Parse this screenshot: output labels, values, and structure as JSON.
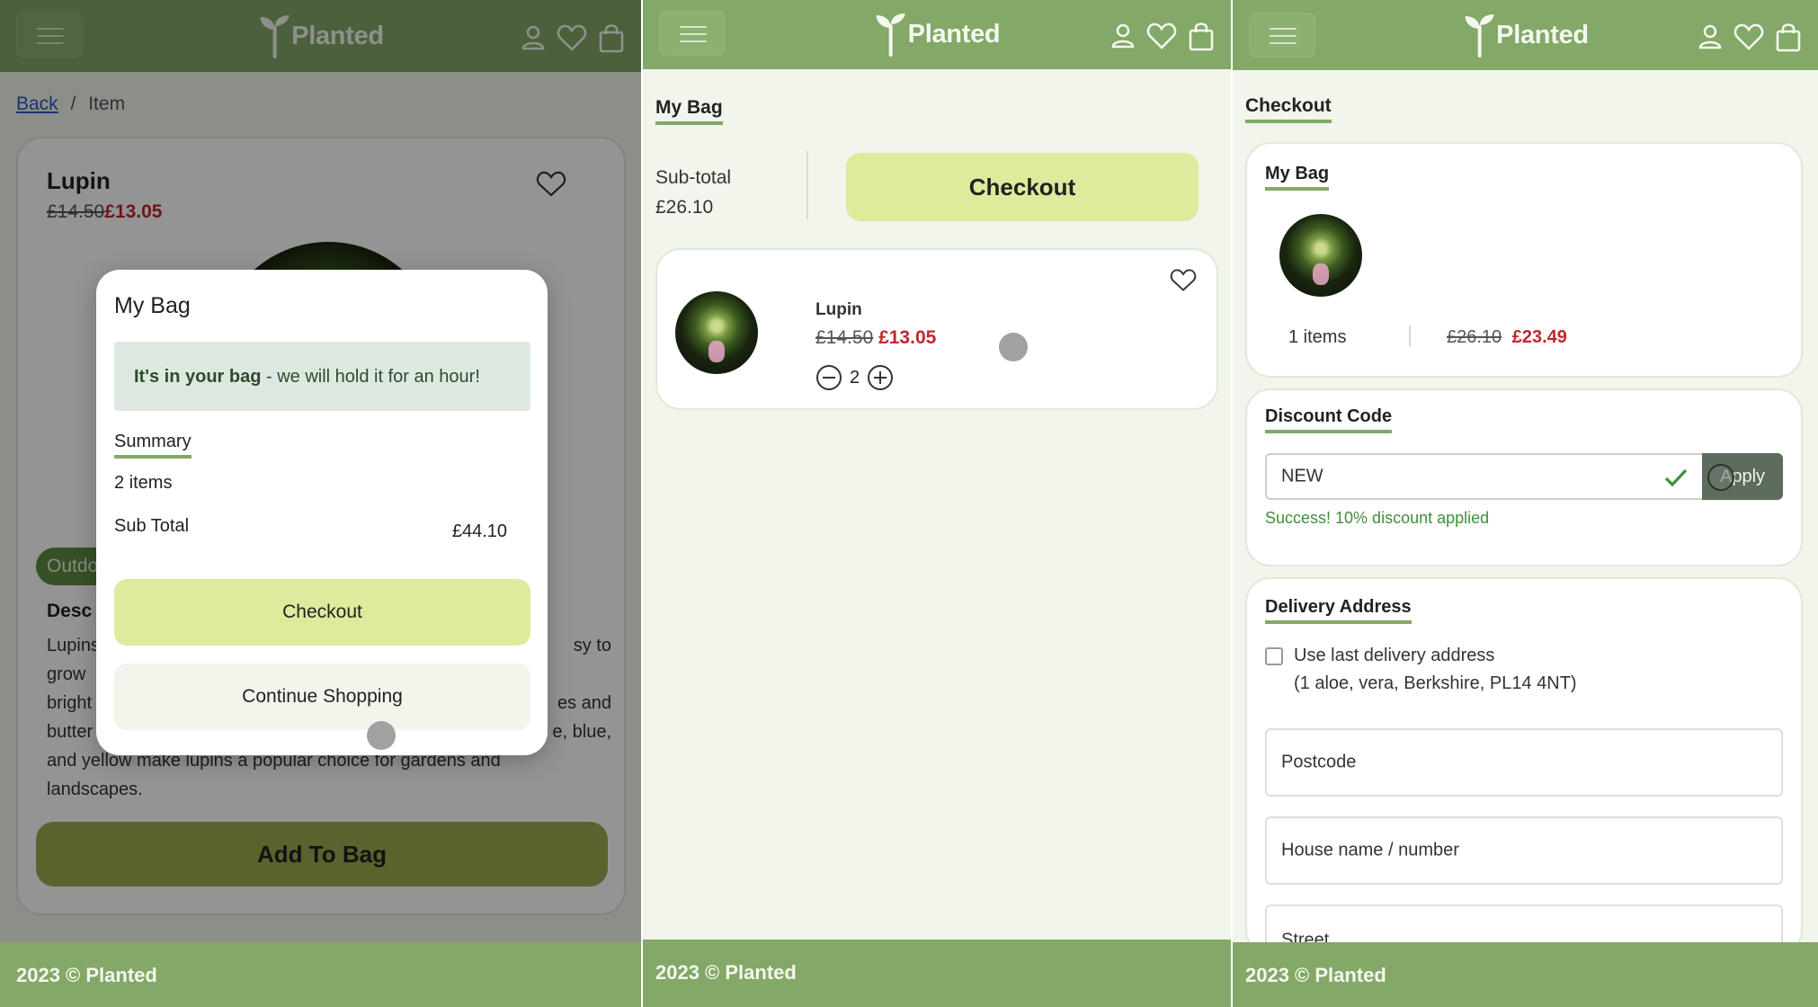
{
  "brand": {
    "name": "Planted",
    "footer": "2023 © Planted"
  },
  "item_screen": {
    "breadcrumb": {
      "back": "Back",
      "separator": "/",
      "current": "Item"
    },
    "product": {
      "name": "Lupin",
      "old_price": "£14.50",
      "price": "£13.05",
      "tag": "Outdo",
      "desc_heading": "Desc",
      "desc_lines_left": [
        "Lupins",
        "grow",
        "bright",
        "butter",
        "and yellow make lupins a popular choice for gardens and",
        "landscapes."
      ],
      "desc_lines_right": [
        "sy to",
        "",
        "es and",
        "e, blue,"
      ]
    },
    "add_to_bag": "Add To Bag",
    "modal": {
      "title": "My Bag",
      "notice_bold": "It's in your bag",
      "notice_rest": " - we will hold it for an hour!",
      "summary_heading": "Summary",
      "items_count": "2 items",
      "subtotal_label": "Sub Total",
      "subtotal_value": "£44.10",
      "checkout": "Checkout",
      "continue": "Continue Shopping"
    }
  },
  "bag_screen": {
    "title": "My Bag",
    "subtotal_label": "Sub-total",
    "subtotal_value": "£26.10",
    "checkout": "Checkout",
    "item": {
      "name": "Lupin",
      "old_price": "£14.50",
      "price": "£13.05",
      "qty": "2"
    }
  },
  "checkout_screen": {
    "title": "Checkout",
    "bag": {
      "heading": "My Bag",
      "items": "1 items",
      "old_total": "£26.10",
      "total": "£23.49"
    },
    "discount": {
      "heading": "Discount Code",
      "value": "NEW",
      "apply": "Apply",
      "success": "Success! 10% discount applied"
    },
    "delivery": {
      "heading": "Delivery Address",
      "use_last": "Use last delivery address",
      "last_address": "(1 aloe, vera, Berkshire, PL14 4NT)",
      "postcode": "Postcode",
      "house": "House name / number",
      "street": "Street"
    }
  },
  "colors": {
    "brand_green": "#83a867",
    "lime": "#deea9c",
    "sale_red": "#c2272d",
    "success_green": "#3f8f3a"
  },
  "icons": [
    "menu-icon",
    "sprout-logo-icon",
    "user-icon",
    "heart-icon",
    "bag-icon",
    "minus-circle-icon",
    "plus-circle-icon",
    "check-icon"
  ]
}
